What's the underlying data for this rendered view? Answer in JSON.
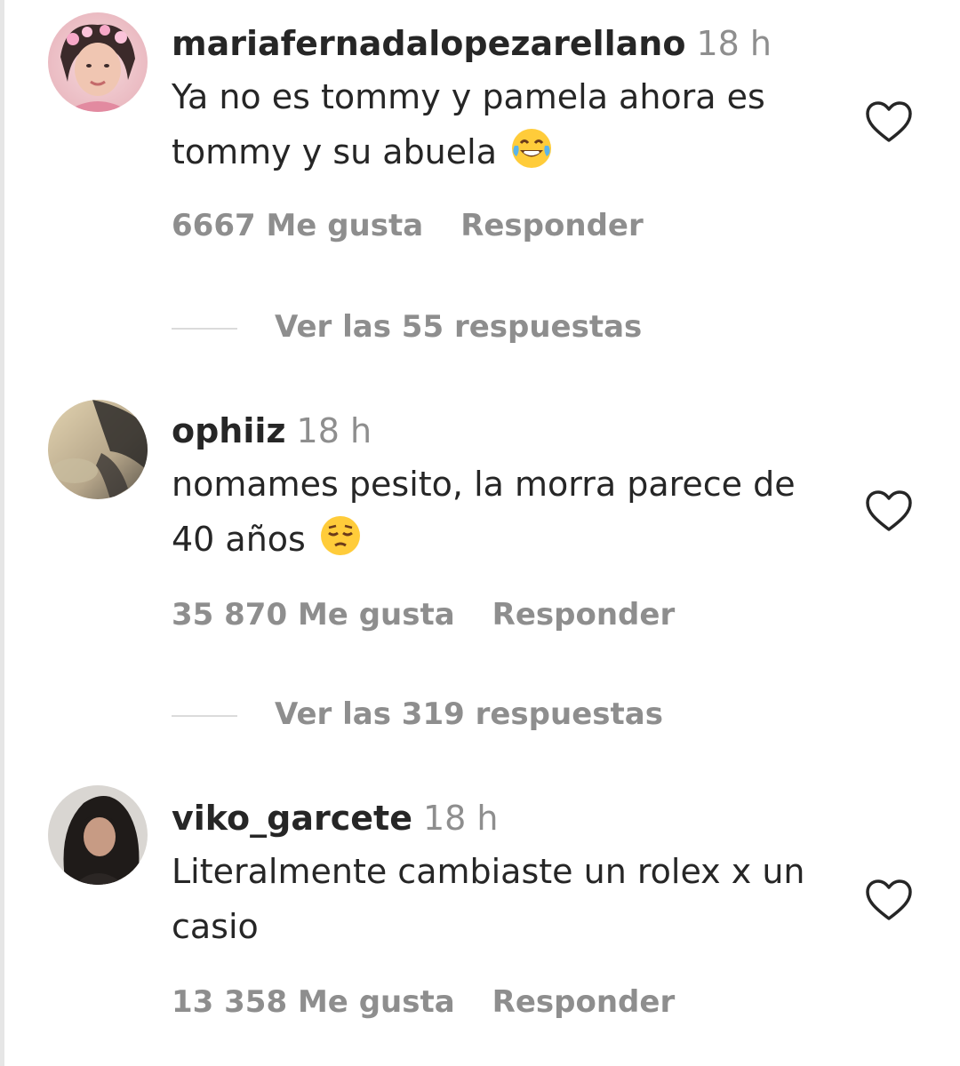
{
  "comments": [
    {
      "username": "mariafernadalopezarellano",
      "time": "18 h",
      "text": "Ya no es tommy y pamela ahora es tommy y su abuela",
      "emoji": "face-with-tears-of-joy",
      "likes": "6667 Me gusta",
      "reply_label": "Responder",
      "view_replies": "Ver las 55 respuestas"
    },
    {
      "username": "ophiiz",
      "time": "18 h",
      "text": "nomames pesito, la morra parece de 40 años",
      "emoji": "pensive-face",
      "likes": "35 870 Me gusta",
      "reply_label": "Responder",
      "view_replies": "Ver las 319 respuestas"
    },
    {
      "username": "viko_garcete",
      "time": "18 h",
      "text": "Literalmente cambiaste un rolex x un casio",
      "likes": "13 358 Me gusta",
      "reply_label": "Responder"
    }
  ],
  "icons": {
    "like": "heart-outline-icon"
  },
  "colors": {
    "text": "#262626",
    "muted": "#8e8e8e",
    "divider": "#dbdbdb"
  }
}
